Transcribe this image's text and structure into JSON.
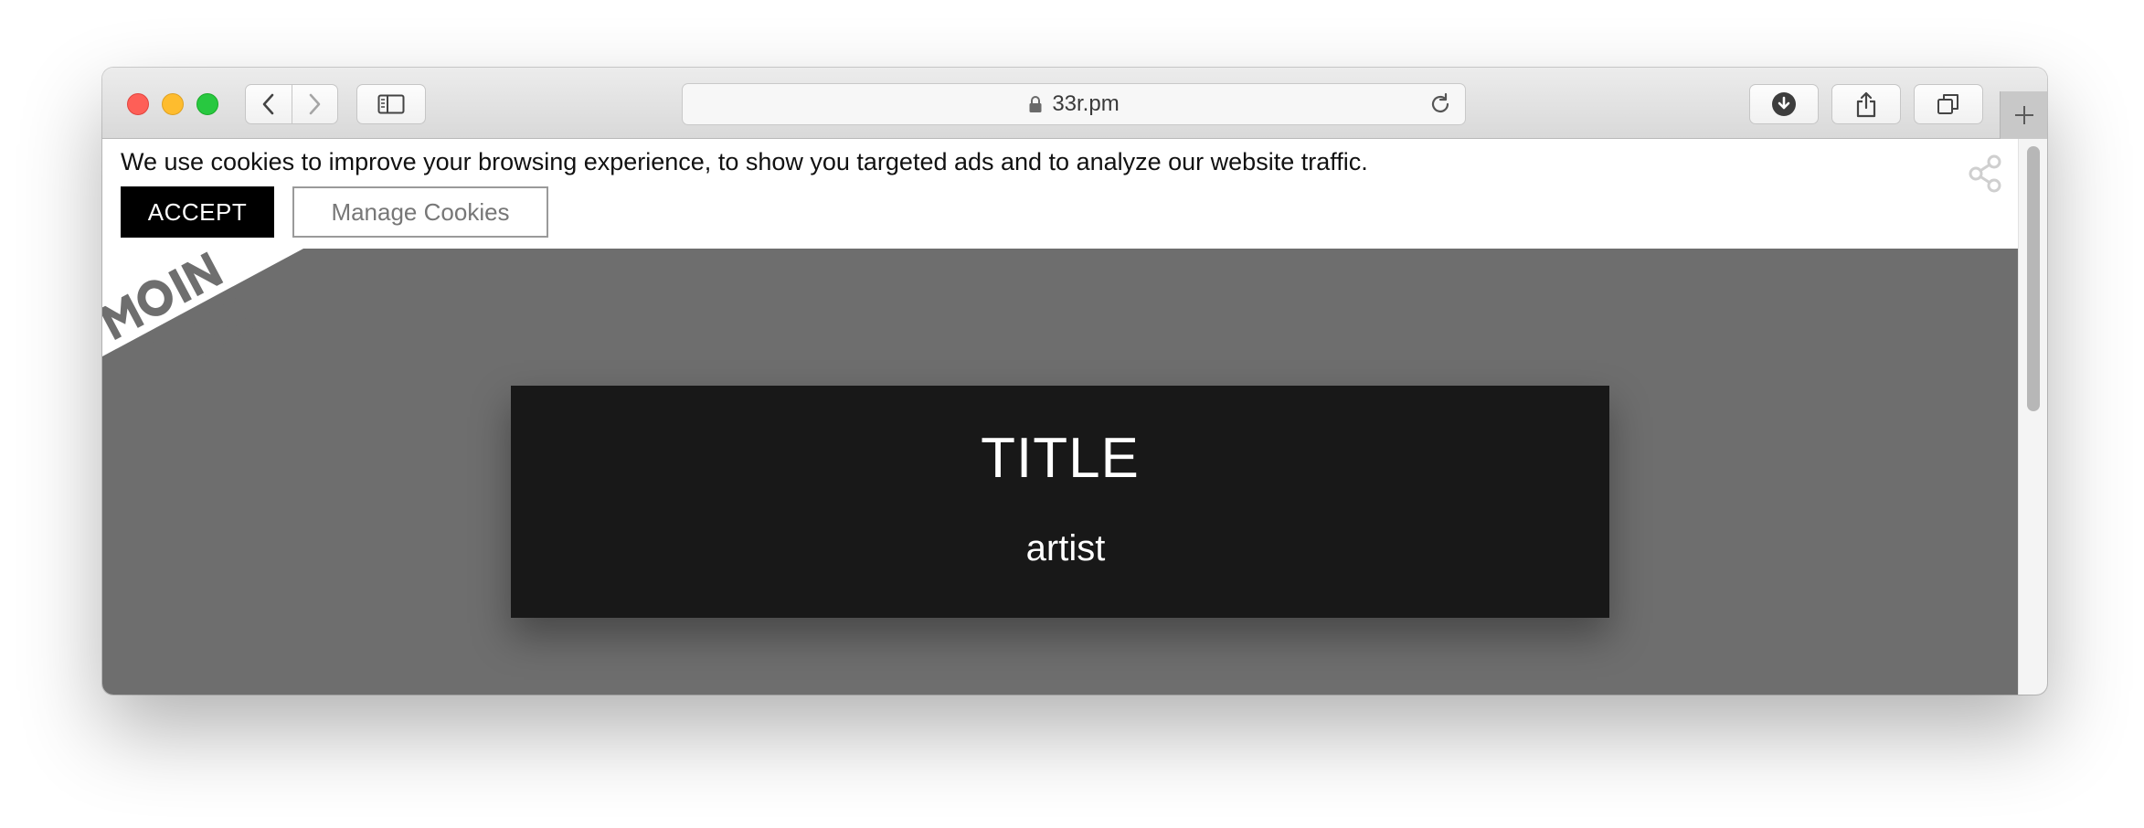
{
  "browser": {
    "url": "33r.pm",
    "new_tab_label": "+"
  },
  "cookie_banner": {
    "message": "We use cookies to improve your browsing experience, to show you targeted ads and to analyze our website traffic.",
    "accept_label": "ACCEPT",
    "manage_label": "Manage Cookies"
  },
  "logo": {
    "text": "MOIN LINK"
  },
  "card": {
    "title": "TITLE",
    "artist": "artist"
  },
  "icons": {
    "back": "chevron-left-icon",
    "forward": "chevron-right-icon",
    "sidebar": "sidebar-icon",
    "lock": "lock-icon",
    "reload": "reload-icon",
    "download": "download-icon",
    "share": "share-icon",
    "tabs": "tabs-overview-icon",
    "page_share": "share-nodes-icon"
  },
  "colors": {
    "traffic_close": "#fe5f57",
    "traffic_minimize": "#febc2e",
    "traffic_maximize": "#28c840",
    "page_background": "#6e6e6e",
    "card_background": "#181818",
    "accept_button": "#000000"
  }
}
